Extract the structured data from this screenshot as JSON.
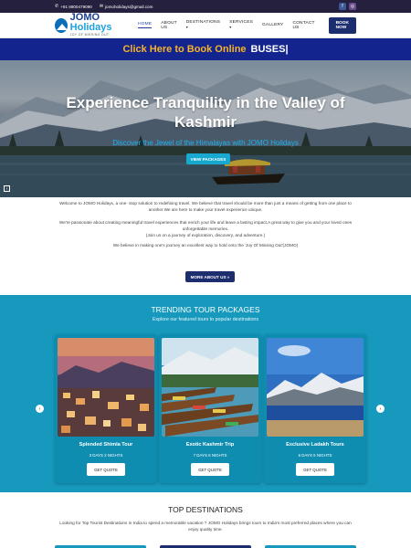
{
  "topbar": {
    "phone": "+91 8800479090",
    "email": "jomoholidays@gmail.com",
    "social": [
      "facebook-icon",
      "instagram-icon"
    ]
  },
  "logo": {
    "main_a": "JOMO",
    "main_b": "Holidays",
    "tagline": "JOY OF MISSING OUT"
  },
  "nav": {
    "items": [
      "HOME",
      "ABOUT US",
      "DESTINATIONS",
      "SERVICES",
      "GALLERY",
      "CONTACT US"
    ],
    "active": "HOME",
    "book_label": "BOOK NOW"
  },
  "bookbar": {
    "text_a": "Click Here to Book Online",
    "text_b": "BUSES|"
  },
  "hero": {
    "title": "Experience Tranquility in the Valley of Kashmir",
    "subtitle": "Discover the Jewel of the Himalayas with JOMO Holidays",
    "button": "VIEW PACKAGES",
    "arrow": "‹"
  },
  "about": {
    "p1": "Welcome to JOMO Holidays, a one- stop solution to redefining travel. We believe that travel should be more than just a means of getting from one place to another.We are here to make your travel experience unique.",
    "p2": "We're passionate about creating meaningful travel experiences that enrich your life and leave a lasting impact.A great way to give you and your loved ones unforgettable memories.",
    "p3": "(Join us on a journey of exploration, discovery, and adventure.)",
    "p4": "We believe in making one's journey an excellent way to hold onto the 'Joy Of Missing Out'(JOMO)",
    "button": "MORE ABOUT US »"
  },
  "trending": {
    "title": "TRENDING TOUR PACKAGES",
    "subtitle": "Explore our featured tours to popular destinations",
    "cards": [
      {
        "title": "Splended Shimla Tour",
        "days": "3 DAYS 2 NIGHTS",
        "button": "GET QUOTE"
      },
      {
        "title": "Exotic Kashmir Trip",
        "days": "7 DAYS 6 NIGHTS",
        "button": "GET QUOTE"
      },
      {
        "title": "Exclusive Ladakh Tours",
        "days": "6 DAYS 5 NIGHTS",
        "button": "GET QUOTE"
      }
    ],
    "prev": "‹",
    "next": "›"
  },
  "destinations": {
    "title": "TOP DESTINATIONS",
    "text": "Looking for Top Tourist Destinations in India to spend a memorable vacation ? JOMO Holidays brings tours to India's most preferred places where you can enjoy quality time."
  },
  "colors": {
    "topbar": "#24203e",
    "brand_navy": "#1c2e6e",
    "book_bar": "#14248f",
    "book_highlight": "#f5b32b",
    "accent_cyan": "#17a9cf",
    "trending_bg": "#1699bd"
  }
}
